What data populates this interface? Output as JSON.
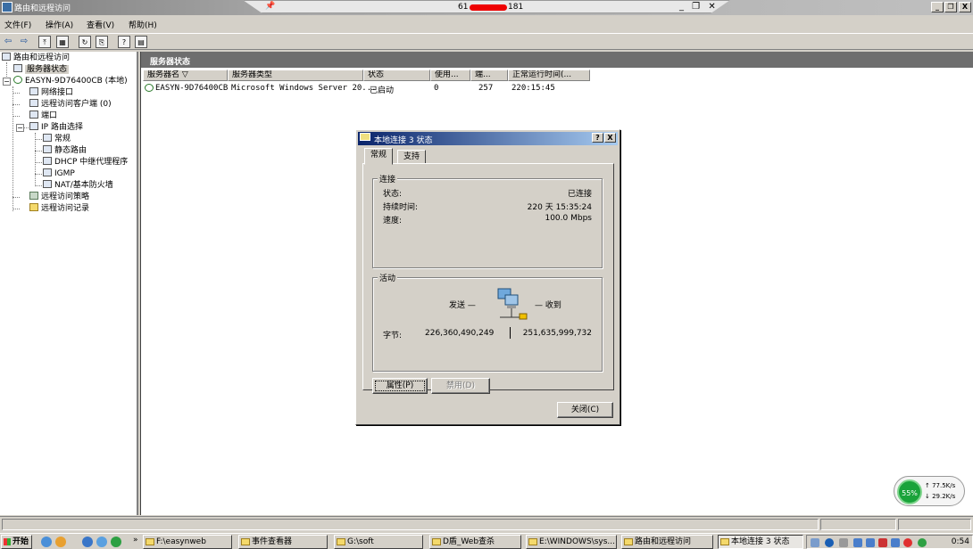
{
  "window": {
    "title": "路由和远程访问",
    "caption_buttons": [
      "_",
      "❐",
      "X"
    ]
  },
  "remote_bar": {
    "pin_icon": "pin-icon",
    "address_left": "61",
    "address_right": "181",
    "buttons": "_ ❐ ✕"
  },
  "menu": [
    "文件(F)",
    "操作(A)",
    "查看(V)",
    "帮助(H)"
  ],
  "toolbar": [
    "back-arrow-icon",
    "forward-arrow-icon",
    "up-folder-icon",
    "show-tree-icon",
    "refresh-icon",
    "export-icon",
    "help-icon",
    "properties-icon"
  ],
  "tree": {
    "root": "路由和远程访问",
    "server_status": "服务器状态",
    "server": "EASYN-9D76400CB (本地)",
    "network_interfaces": "网络接口",
    "remote_clients": "远程访问客户端 (0)",
    "ports": "端口",
    "ip_routing": "IP 路由选择",
    "general": "常规",
    "static_routes": "静态路由",
    "dhcp_relay": "DHCP 中继代理程序",
    "igmp": "IGMP",
    "nat_firewall": "NAT/基本防火墙",
    "access_policy": "远程访问策略",
    "access_log": "远程访问记录"
  },
  "right_pane": {
    "header": "服务器状态",
    "columns": [
      "服务器名 ▽",
      "服务器类型",
      "状态",
      "使用...",
      "端...",
      "正常运行时间(..."
    ],
    "row": [
      "EASYN-9D76400CB",
      "Microsoft Windows Server 20...",
      "已启动",
      "0",
      "257",
      "220:15:45"
    ]
  },
  "dialog": {
    "title": "本地连接 3 状态",
    "help_btn": "?",
    "close_btn": "X",
    "tabs": [
      "常规",
      "支持"
    ],
    "connection_group": "连接",
    "status_label": "状态:",
    "status_value": "已连接",
    "duration_label": "持续时间:",
    "duration_value": "220 天 15:35:24",
    "speed_label": "速度:",
    "speed_value": "100.0 Mbps",
    "activity_group": "活动",
    "sent_label": "发送 —",
    "received_label": "— 收到",
    "bytes_label": "字节:",
    "bytes_sent": "226,360,490,249",
    "bytes_received": "251,635,999,732",
    "properties_btn": "属性(P)",
    "disable_btn": "禁用(D)",
    "close_button": "关闭(C)"
  },
  "net_widget": {
    "percent": "55%",
    "upload": "↑ 77.5K/s",
    "download": "↓ 29.2K/s"
  },
  "taskbar": {
    "start": "开始",
    "more": "»",
    "tasks": [
      "F:\\easynweb",
      "事件查看器",
      "G:\\soft",
      "D盾_Web查杀",
      "E:\\WINDOWS\\sys...",
      "路由和远程访问",
      "本地连接 3 状态"
    ],
    "clock": "0:54"
  },
  "colors": {
    "title_active": "#0a246a",
    "accent_green": "#1aa33a",
    "mask_red": "#ee0000"
  }
}
